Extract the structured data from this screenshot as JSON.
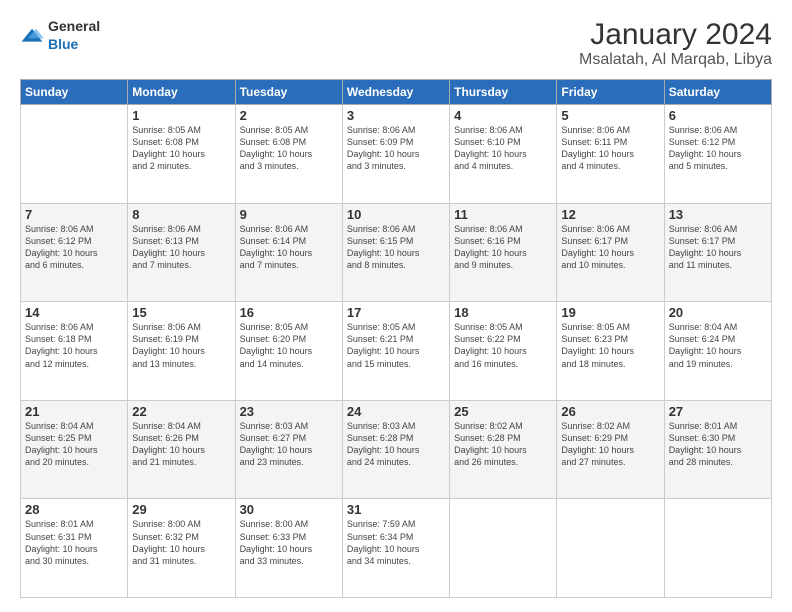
{
  "header": {
    "logo": {
      "general": "General",
      "blue": "Blue"
    },
    "title": "January 2024",
    "subtitle": "Msalatah, Al Marqab, Libya"
  },
  "columns": [
    "Sunday",
    "Monday",
    "Tuesday",
    "Wednesday",
    "Thursday",
    "Friday",
    "Saturday"
  ],
  "weeks": [
    [
      {
        "day": "",
        "info": ""
      },
      {
        "day": "1",
        "info": "Sunrise: 8:05 AM\nSunset: 6:08 PM\nDaylight: 10 hours\nand 2 minutes."
      },
      {
        "day": "2",
        "info": "Sunrise: 8:05 AM\nSunset: 6:08 PM\nDaylight: 10 hours\nand 3 minutes."
      },
      {
        "day": "3",
        "info": "Sunrise: 8:06 AM\nSunset: 6:09 PM\nDaylight: 10 hours\nand 3 minutes."
      },
      {
        "day": "4",
        "info": "Sunrise: 8:06 AM\nSunset: 6:10 PM\nDaylight: 10 hours\nand 4 minutes."
      },
      {
        "day": "5",
        "info": "Sunrise: 8:06 AM\nSunset: 6:11 PM\nDaylight: 10 hours\nand 4 minutes."
      },
      {
        "day": "6",
        "info": "Sunrise: 8:06 AM\nSunset: 6:12 PM\nDaylight: 10 hours\nand 5 minutes."
      }
    ],
    [
      {
        "day": "7",
        "info": "Sunrise: 8:06 AM\nSunset: 6:12 PM\nDaylight: 10 hours\nand 6 minutes."
      },
      {
        "day": "8",
        "info": "Sunrise: 8:06 AM\nSunset: 6:13 PM\nDaylight: 10 hours\nand 7 minutes."
      },
      {
        "day": "9",
        "info": "Sunrise: 8:06 AM\nSunset: 6:14 PM\nDaylight: 10 hours\nand 7 minutes."
      },
      {
        "day": "10",
        "info": "Sunrise: 8:06 AM\nSunset: 6:15 PM\nDaylight: 10 hours\nand 8 minutes."
      },
      {
        "day": "11",
        "info": "Sunrise: 8:06 AM\nSunset: 6:16 PM\nDaylight: 10 hours\nand 9 minutes."
      },
      {
        "day": "12",
        "info": "Sunrise: 8:06 AM\nSunset: 6:17 PM\nDaylight: 10 hours\nand 10 minutes."
      },
      {
        "day": "13",
        "info": "Sunrise: 8:06 AM\nSunset: 6:17 PM\nDaylight: 10 hours\nand 11 minutes."
      }
    ],
    [
      {
        "day": "14",
        "info": "Sunrise: 8:06 AM\nSunset: 6:18 PM\nDaylight: 10 hours\nand 12 minutes."
      },
      {
        "day": "15",
        "info": "Sunrise: 8:06 AM\nSunset: 6:19 PM\nDaylight: 10 hours\nand 13 minutes."
      },
      {
        "day": "16",
        "info": "Sunrise: 8:05 AM\nSunset: 6:20 PM\nDaylight: 10 hours\nand 14 minutes."
      },
      {
        "day": "17",
        "info": "Sunrise: 8:05 AM\nSunset: 6:21 PM\nDaylight: 10 hours\nand 15 minutes."
      },
      {
        "day": "18",
        "info": "Sunrise: 8:05 AM\nSunset: 6:22 PM\nDaylight: 10 hours\nand 16 minutes."
      },
      {
        "day": "19",
        "info": "Sunrise: 8:05 AM\nSunset: 6:23 PM\nDaylight: 10 hours\nand 18 minutes."
      },
      {
        "day": "20",
        "info": "Sunrise: 8:04 AM\nSunset: 6:24 PM\nDaylight: 10 hours\nand 19 minutes."
      }
    ],
    [
      {
        "day": "21",
        "info": "Sunrise: 8:04 AM\nSunset: 6:25 PM\nDaylight: 10 hours\nand 20 minutes."
      },
      {
        "day": "22",
        "info": "Sunrise: 8:04 AM\nSunset: 6:26 PM\nDaylight: 10 hours\nand 21 minutes."
      },
      {
        "day": "23",
        "info": "Sunrise: 8:03 AM\nSunset: 6:27 PM\nDaylight: 10 hours\nand 23 minutes."
      },
      {
        "day": "24",
        "info": "Sunrise: 8:03 AM\nSunset: 6:28 PM\nDaylight: 10 hours\nand 24 minutes."
      },
      {
        "day": "25",
        "info": "Sunrise: 8:02 AM\nSunset: 6:28 PM\nDaylight: 10 hours\nand 26 minutes."
      },
      {
        "day": "26",
        "info": "Sunrise: 8:02 AM\nSunset: 6:29 PM\nDaylight: 10 hours\nand 27 minutes."
      },
      {
        "day": "27",
        "info": "Sunrise: 8:01 AM\nSunset: 6:30 PM\nDaylight: 10 hours\nand 28 minutes."
      }
    ],
    [
      {
        "day": "28",
        "info": "Sunrise: 8:01 AM\nSunset: 6:31 PM\nDaylight: 10 hours\nand 30 minutes."
      },
      {
        "day": "29",
        "info": "Sunrise: 8:00 AM\nSunset: 6:32 PM\nDaylight: 10 hours\nand 31 minutes."
      },
      {
        "day": "30",
        "info": "Sunrise: 8:00 AM\nSunset: 6:33 PM\nDaylight: 10 hours\nand 33 minutes."
      },
      {
        "day": "31",
        "info": "Sunrise: 7:59 AM\nSunset: 6:34 PM\nDaylight: 10 hours\nand 34 minutes."
      },
      {
        "day": "",
        "info": ""
      },
      {
        "day": "",
        "info": ""
      },
      {
        "day": "",
        "info": ""
      }
    ]
  ]
}
